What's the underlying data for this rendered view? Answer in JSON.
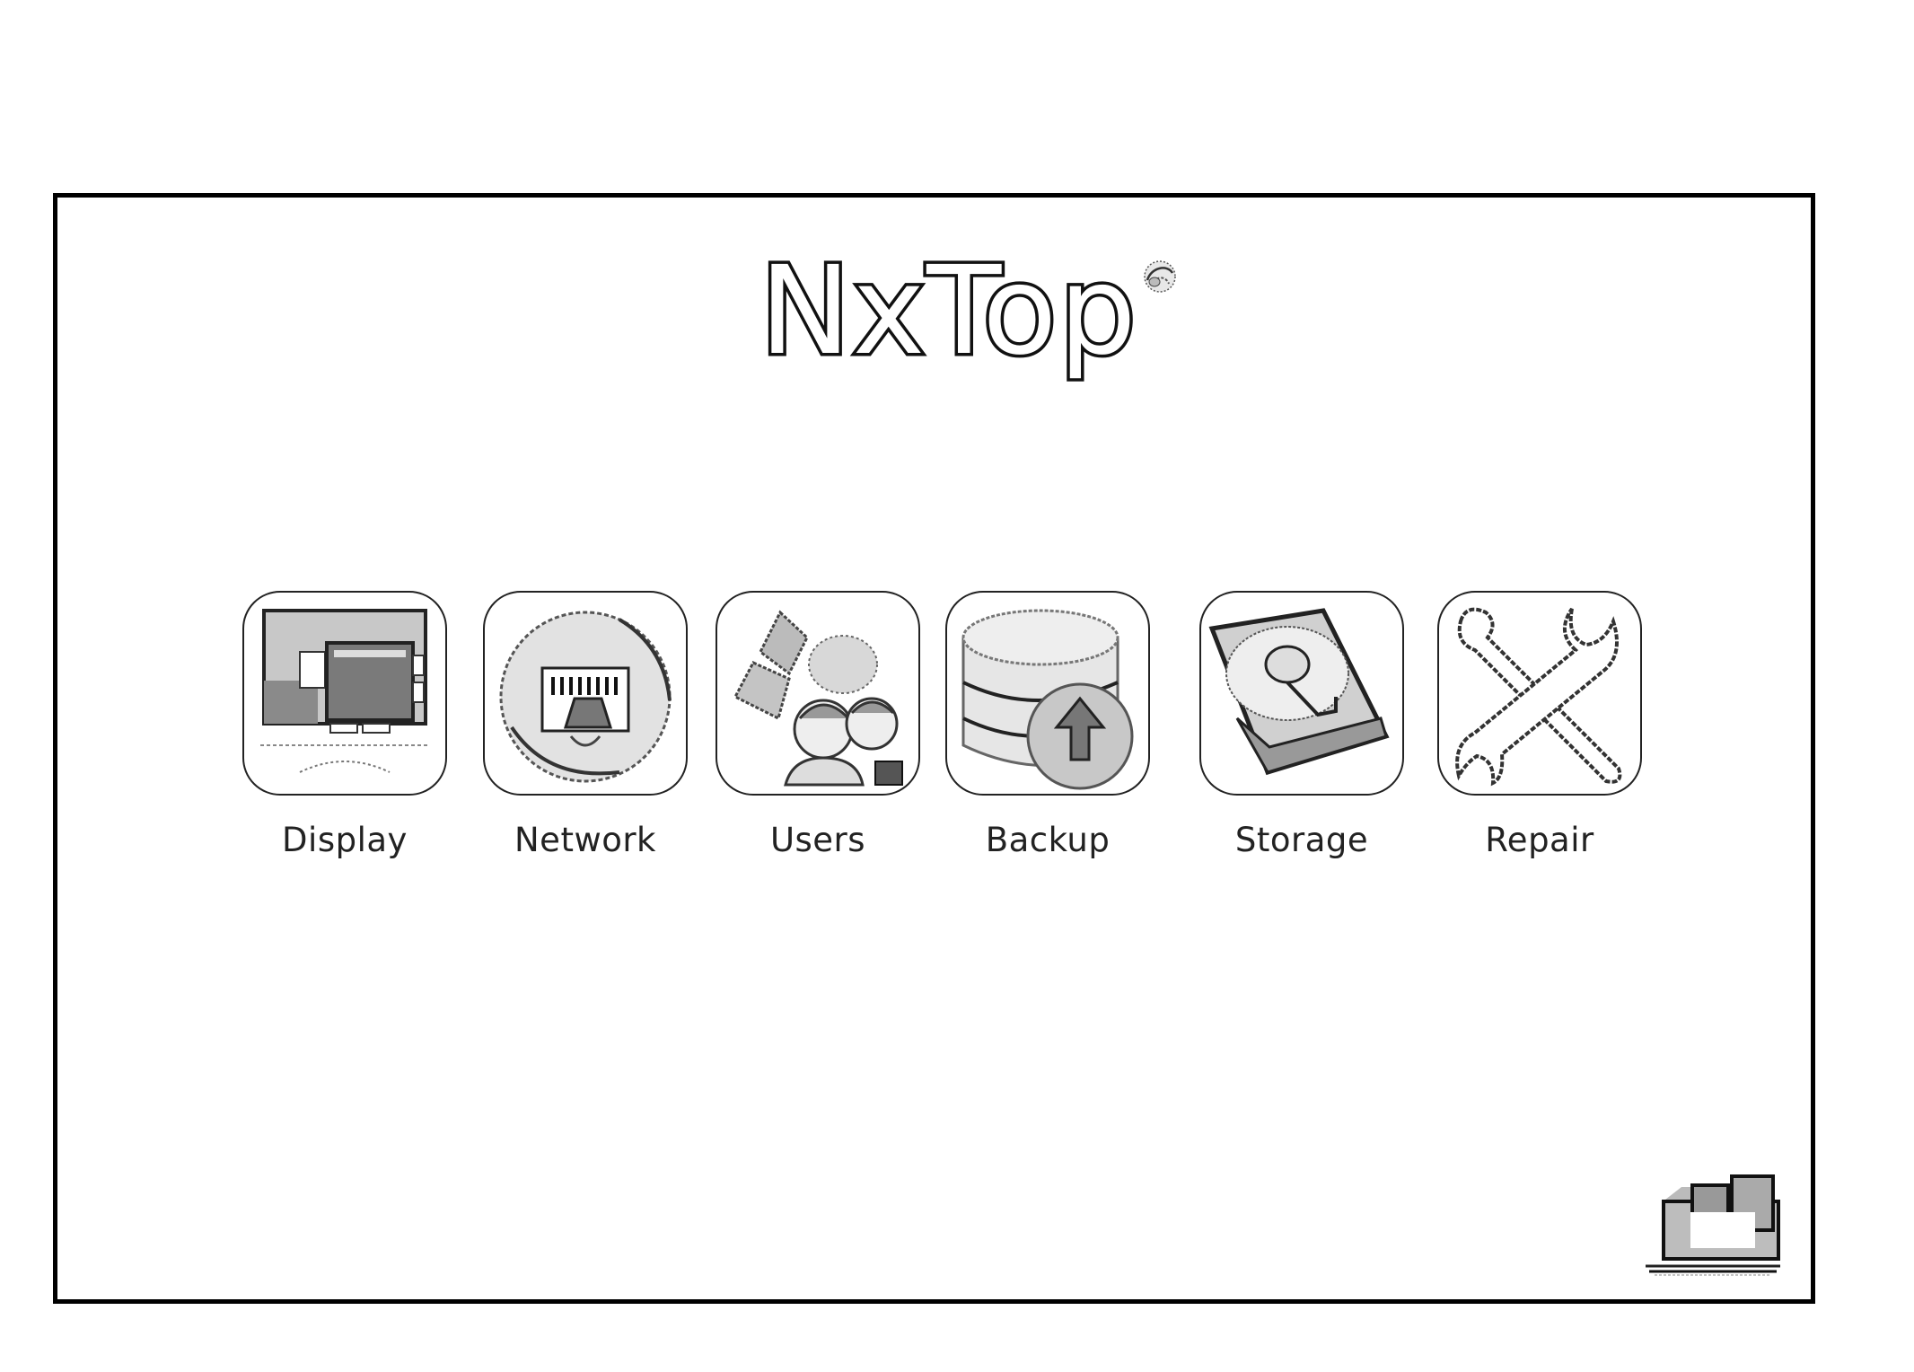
{
  "app": {
    "logo_text": "NxTop",
    "logo_mark_icon": "swirl-globe-icon"
  },
  "tiles": [
    {
      "id": "display",
      "label": "Display",
      "icon": "monitor-icon"
    },
    {
      "id": "network",
      "label": "Network",
      "icon": "network-globe-icon"
    },
    {
      "id": "users",
      "label": "Users",
      "icon": "users-icon"
    },
    {
      "id": "backup",
      "label": "Backup",
      "icon": "database-backup-icon"
    },
    {
      "id": "storage",
      "label": "Storage",
      "icon": "hard-drive-icon"
    },
    {
      "id": "repair",
      "label": "Repair",
      "icon": "wrench-screwdriver-icon"
    }
  ],
  "corner_action": {
    "icon": "laptop-desktop-icon"
  },
  "colors": {
    "border": "#000000",
    "background": "#ffffff",
    "icon_gray": "#9a9a9a"
  }
}
